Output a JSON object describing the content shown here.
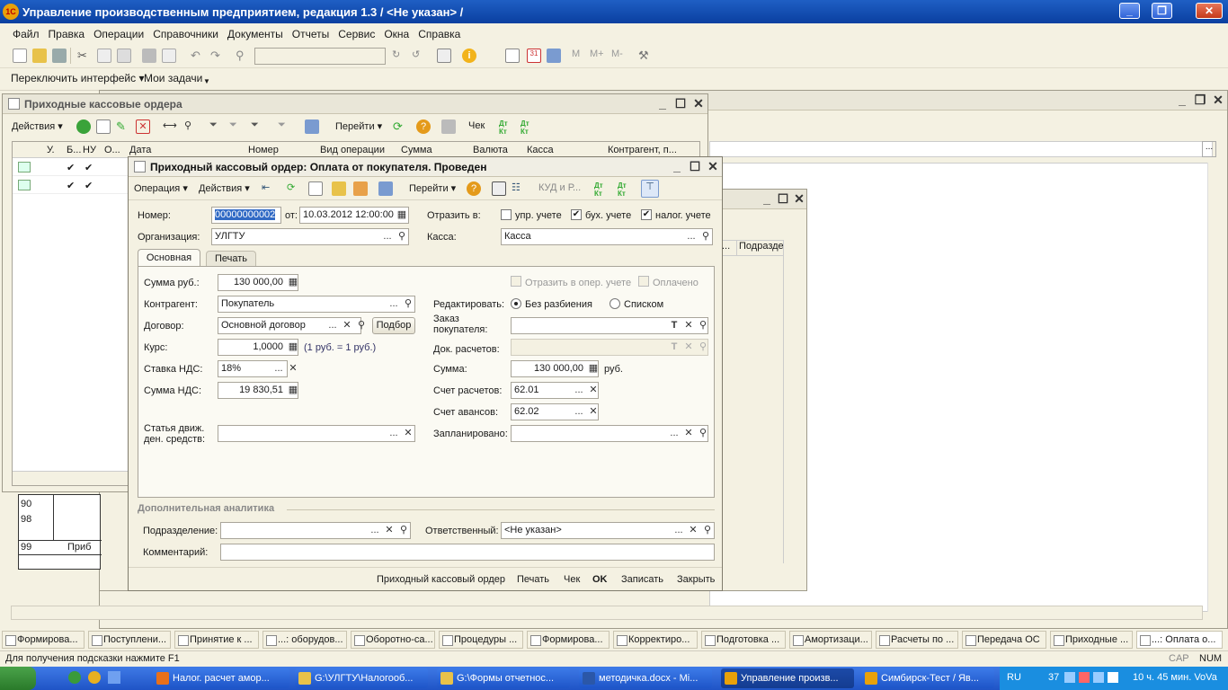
{
  "app": {
    "title": "Управление производственным предприятием, редакция 1.3 / <Не указан> /",
    "logo": "1С"
  },
  "menu": [
    "Файл",
    "Правка",
    "Операции",
    "Справочники",
    "Документы",
    "Отчеты",
    "Сервис",
    "Окна",
    "Справка"
  ],
  "toolbar2": {
    "switch_interface": "Переключить интерфейс",
    "my_tasks": "Мои задачи"
  },
  "list_window": {
    "title": "Приходные кассовые ордера",
    "actions": "Действия",
    "goto": "Перейти",
    "check": "Чек",
    "columns": [
      "У.",
      "Б...",
      "НУ",
      "О...",
      "Дата",
      "Номер",
      "Вид операции",
      "Сумма",
      "Валюта",
      "Касса",
      "Контрагент, п..."
    ],
    "rows": [
      {
        "b": "✔",
        "nu": "✔"
      },
      {
        "b": "✔",
        "nu": "✔"
      }
    ]
  },
  "bg_window": {
    "col_short": "...",
    "col_podr": "Подразде",
    "rows": [
      "90",
      "98",
      "99"
    ],
    "row_text": "Приб"
  },
  "doc": {
    "title": "Приходный кассовый ордер: Оплата от покупателя. Проведен",
    "toolbar": {
      "operation": "Операция",
      "actions": "Действия",
      "kud": "КУД и Р...",
      "goto": "Перейти"
    },
    "number_label": "Номер:",
    "number": "00000000002",
    "from_label": "от:",
    "date": "10.03.2012 12:00:00",
    "reflect_label": "Отразить в:",
    "reflect_mgmt": "упр. учете",
    "reflect_acc": "бух. учете",
    "reflect_tax": "налог. учете",
    "org_label": "Организация:",
    "org": "УЛГТУ",
    "cash_label": "Касса:",
    "cash": "Касса",
    "tabs": [
      "Основная",
      "Печать"
    ],
    "sum_rub_label": "Сумма руб.:",
    "sum_rub": "130 000,00",
    "reflect_oper": "Отразить в опер. учете",
    "paid": "Оплачено",
    "counterparty_label": "Контрагент:",
    "counterparty": "Покупатель",
    "edit_label": "Редактировать:",
    "edit_opt1": "Без разбиения",
    "edit_opt2": "Списком",
    "contract_label": "Договор:",
    "contract": "Основной договор",
    "pick_button": "Подбор",
    "order_label": "Заказ покупателя:",
    "docs_label": "Док. расчетов:",
    "rate_label": "Курс:",
    "rate": "1,0000",
    "rate_note": "(1 руб. = 1 руб.)",
    "sum_label": "Сумма:",
    "sum": "130 000,00",
    "currency": "руб.",
    "vat_rate_label": "Ставка НДС:",
    "vat_rate": "18%",
    "acc_label": "Счет расчетов:",
    "acc": "62.01",
    "vat_sum_label": "Сумма НДС:",
    "vat_sum": "19 830,51",
    "adv_label": "Счет авансов:",
    "adv": "62.02",
    "cashflow_label": "Статья движ. ден. средств:",
    "planned_label": "Запланировано:",
    "analytics_title": "Дополнительная аналитика",
    "dept_label": "Подразделение:",
    "resp_label": "Ответственный:",
    "resp": "<Не указан>",
    "comment_label": "Комментарий:",
    "footer": [
      "Приходный кассовый ордер",
      "Печать",
      "Чек",
      "OK",
      "Записать",
      "Закрыть"
    ]
  },
  "taskbar": [
    "Формирова...",
    "Поступлени...",
    "Принятие к ...",
    "...: оборудов...",
    "Оборотно-са...",
    "Процедуры ...",
    "Формирова...",
    "Корректиро...",
    "Подготовка ...",
    "Амортизаци...",
    "Расчеты по ...",
    "Передача ОС",
    "Приходные ...",
    "...: Оплата о..."
  ],
  "status": {
    "hint": "Для получения подсказки нажмите F1",
    "cap": "CAP",
    "num": "NUM"
  },
  "win_taskbar": [
    "Налог. расчет амор...",
    "G:\\УЛГТУ\\Налогооб...",
    "G:\\Формы отчетнос...",
    "методичка.docx - Mi...",
    "Управление произв...",
    "Симбирск-Тест / Яв..."
  ],
  "tray": {
    "lang": "RU",
    "count": "37",
    "clock": "10 ч. 45 мин. VoVa"
  }
}
